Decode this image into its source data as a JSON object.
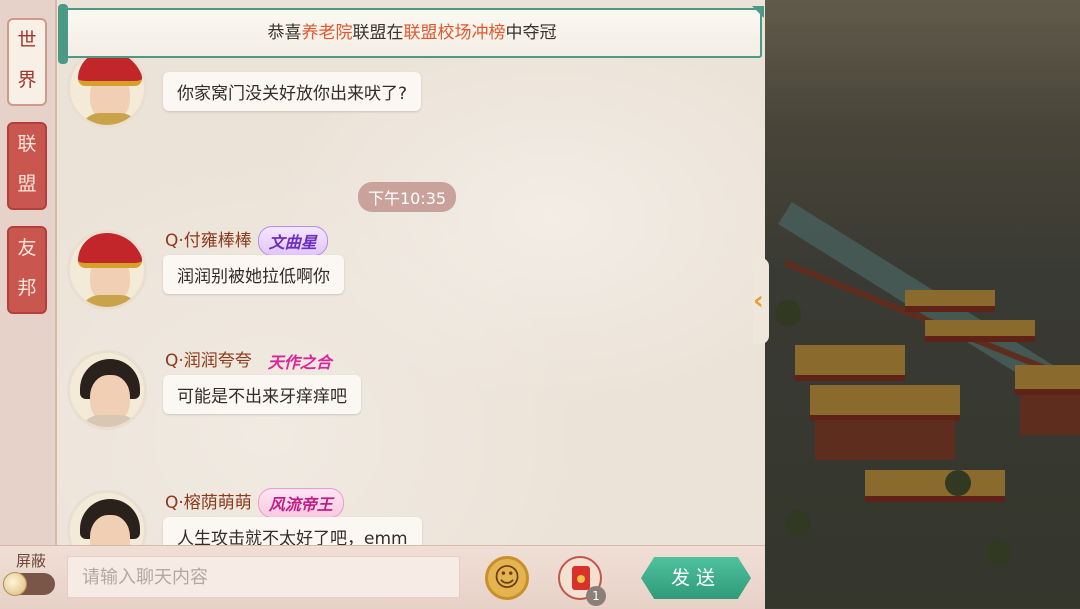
{
  "banner": {
    "prefix": "恭喜",
    "alliance_name": "养老院",
    "middle": "联盟在",
    "event_name": "联盟校场冲榜",
    "suffix": "中夺冠"
  },
  "tabs": [
    {
      "label_top": "世",
      "label_bottom": "界",
      "active": true
    },
    {
      "label_top": "联",
      "label_bottom": "盟",
      "active": false
    },
    {
      "label_top": "友",
      "label_bottom": "邦",
      "active": false
    }
  ],
  "messages": [
    {
      "name": "",
      "title": "",
      "text": "你家窝门没关好放你出来吠了?"
    },
    {
      "name": "Q·付雍棒棒",
      "title": "文曲星",
      "text": "润润别被她拉低啊你"
    },
    {
      "name": "Q·润润夸夸",
      "title": "天作之合",
      "text": "可能是不出来牙痒痒吧"
    },
    {
      "name": "Q·榕荫萌萌",
      "title": "风流帝王",
      "text": "人生攻击就不太好了吧，emm"
    }
  ],
  "timestamp": "下午10:35",
  "bottom": {
    "mute_label": "屏蔽",
    "input_placeholder": "请输入聊天内容",
    "input_value": "",
    "emoji_icon": "☺",
    "redpacket_count": "1",
    "send_label": "发送"
  },
  "colors": {
    "accent_red": "#c9574f",
    "send_green": "#2f9a79",
    "highlight_orange": "#e2572c"
  }
}
